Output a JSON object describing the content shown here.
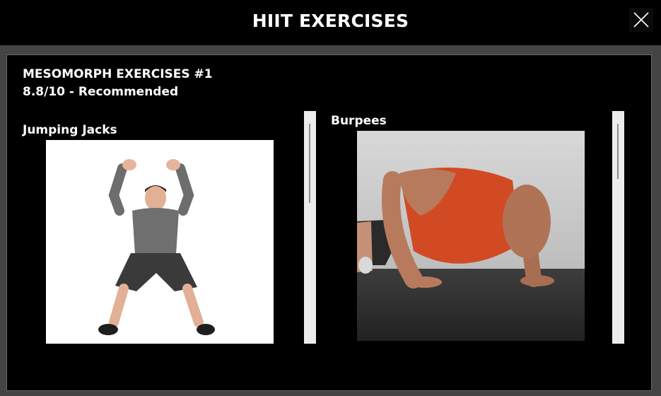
{
  "window": {
    "title": "HIIT EXERCISES"
  },
  "workout": {
    "name": "MESOMORPH EXERCISES #1",
    "rating": "8.8/10 - Recommended"
  },
  "exercises": [
    {
      "label": "Jumping Jacks",
      "icon": "jumping-jacks-photo"
    },
    {
      "label": "Burpees",
      "icon": "burpees-photo"
    }
  ],
  "colors": {
    "background": "#000000",
    "frame": "#444444",
    "text": "#ffffff",
    "scrollbar_track": "#ececec",
    "scrollbar_thumb": "#8e8e8e"
  }
}
